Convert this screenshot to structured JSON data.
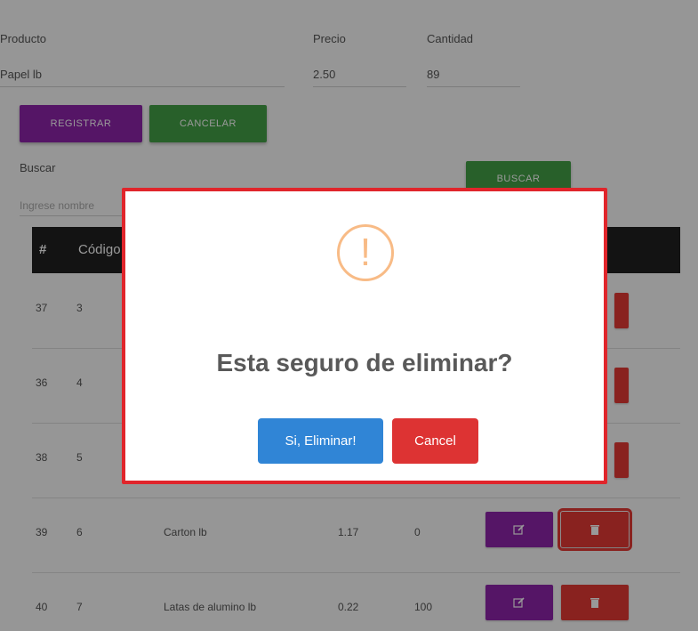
{
  "form": {
    "producto_label": "Producto",
    "producto_value": "Papel lb",
    "precio_label": "Precio",
    "precio_value": "2.50",
    "cantidad_label": "Cantidad",
    "cantidad_value": "89"
  },
  "buttons": {
    "registrar": "REGISTRAR",
    "cancelar": "CANCELAR",
    "buscar": "BUSCAR"
  },
  "search": {
    "label": "Buscar",
    "placeholder": "Ingrese nombre"
  },
  "table": {
    "headers": [
      "#",
      "Código"
    ],
    "rows": [
      {
        "id": "37",
        "codigo": "3",
        "nombre": "",
        "precio": "",
        "cantidad": ""
      },
      {
        "id": "36",
        "codigo": "4",
        "nombre": "",
        "precio": "",
        "cantidad": ""
      },
      {
        "id": "38",
        "codigo": "5",
        "nombre": "",
        "precio": "",
        "cantidad": ""
      },
      {
        "id": "39",
        "codigo": "6",
        "nombre": "Carton lb",
        "precio": "1.17",
        "cantidad": "0"
      },
      {
        "id": "40",
        "codigo": "7",
        "nombre": "Latas de alumino lb",
        "precio": "0.22",
        "cantidad": "100"
      }
    ],
    "edit_icon": "edit-icon",
    "delete_icon": "trash-icon"
  },
  "modal": {
    "icon": "warning-icon",
    "icon_glyph": "!",
    "title": "Esta seguro de eliminar?",
    "confirm_label": "Si, Eliminar!",
    "cancel_label": "Cancel"
  },
  "colors": {
    "primary": "#8e24aa",
    "success": "#43a047",
    "danger": "#e53935",
    "confirm": "#3085d6",
    "warning": "#f8bb86"
  }
}
